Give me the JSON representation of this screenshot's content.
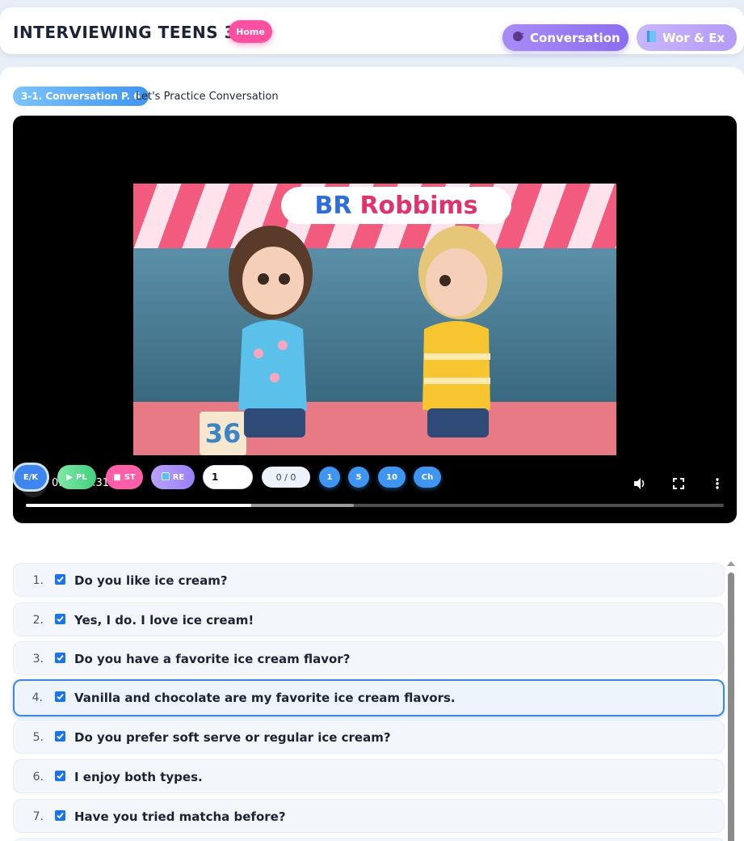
{
  "header": {
    "title": "INTERVIEWING TEENS 3-1",
    "home_label": "Home",
    "nav": [
      {
        "label": "Conversation",
        "icon": "speaking-head-icon"
      },
      {
        "label": "Wor & Ex",
        "icon": "book-icon"
      }
    ]
  },
  "section": {
    "badge": "3-1. Conversation P. 6",
    "title": "Let's Practice Conversation"
  },
  "video": {
    "sign_logo": "BR",
    "sign_text": "Robbims",
    "number_sign": "36",
    "time": "0:10 / 0:31",
    "played_fraction": 0.3226,
    "buffered_fraction": 0.47
  },
  "controls": {
    "ek": "E/K",
    "pl": "PL",
    "st": "ST",
    "re": "RE",
    "index_value": "1",
    "count": "0 / 0",
    "n1": "1",
    "n5": "5",
    "n10": "10",
    "ch": "Ch"
  },
  "sentences": [
    {
      "num": "1.",
      "text": "Do you like ice cream?",
      "checked": true,
      "active": false
    },
    {
      "num": "2.",
      "text": "Yes, I do. I love ice cream!",
      "checked": true,
      "active": false
    },
    {
      "num": "3.",
      "text": "Do you have a favorite ice cream flavor?",
      "checked": true,
      "active": false
    },
    {
      "num": "4.",
      "text": "Vanilla and chocolate are my favorite ice cream flavors.",
      "checked": true,
      "active": true
    },
    {
      "num": "5.",
      "text": "Do you prefer soft serve or regular ice cream?",
      "checked": true,
      "active": false
    },
    {
      "num": "6.",
      "text": "I enjoy both types.",
      "checked": true,
      "active": false
    },
    {
      "num": "7.",
      "text": "Have you tried matcha before?",
      "checked": true,
      "active": false
    }
  ]
}
